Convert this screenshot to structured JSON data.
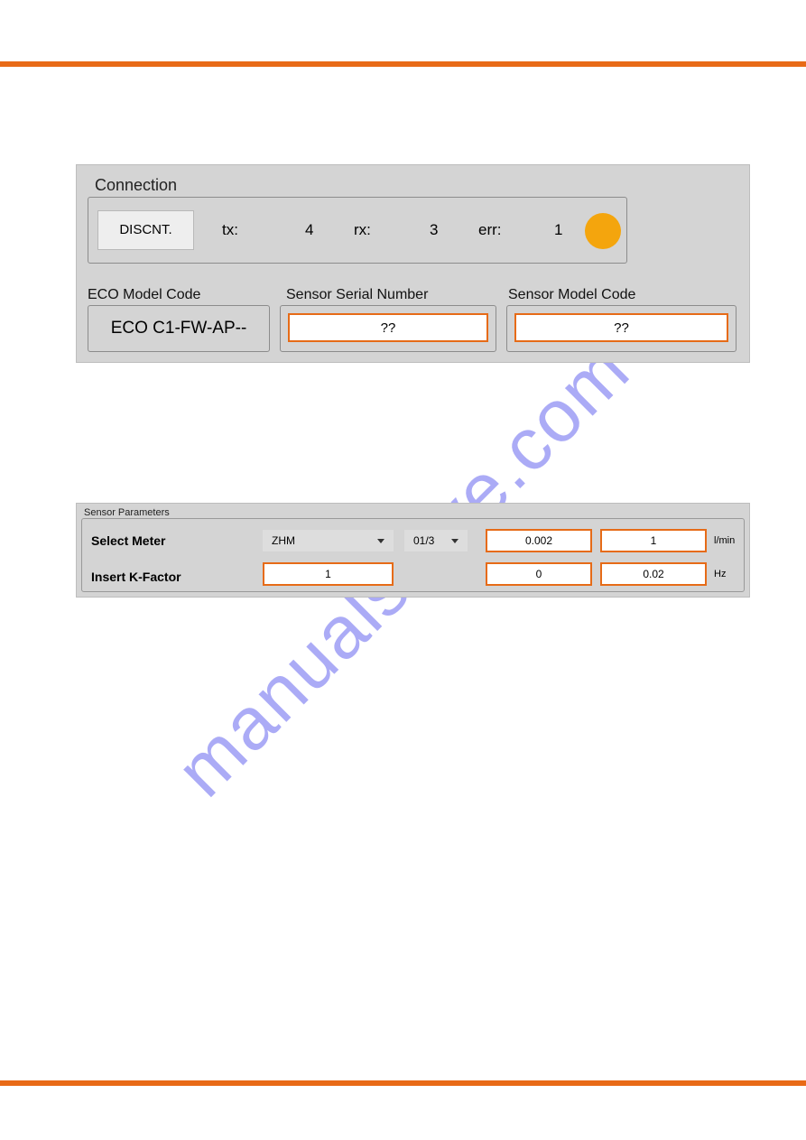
{
  "watermark": "manualshive.com",
  "connection": {
    "title": "Connection",
    "button": "DISCNT.",
    "tx_label": "tx:",
    "tx_value": "4",
    "rx_label": "rx:",
    "rx_value": "3",
    "err_label": "err:",
    "err_value": "1",
    "status_color": "#f4a50d"
  },
  "fields": {
    "eco_label": "ECO Model Code",
    "eco_value": "ECO C1-FW-AP--",
    "ssn_label": "Sensor Serial Number",
    "ssn_value": "??",
    "smc_label": "Sensor Model Code",
    "smc_value": "??"
  },
  "sensor_params": {
    "title": "Sensor Parameters",
    "select_meter_label": "Select Meter",
    "meter_type": "ZHM",
    "meter_size": "01/3",
    "kfactor_label": "Insert K-Factor",
    "kfactor_value": "1",
    "row1": {
      "c1": "0.002",
      "c2": "1",
      "unit": "l/min"
    },
    "row2": {
      "c1": "0",
      "c2": "0.02",
      "unit": "Hz"
    }
  }
}
